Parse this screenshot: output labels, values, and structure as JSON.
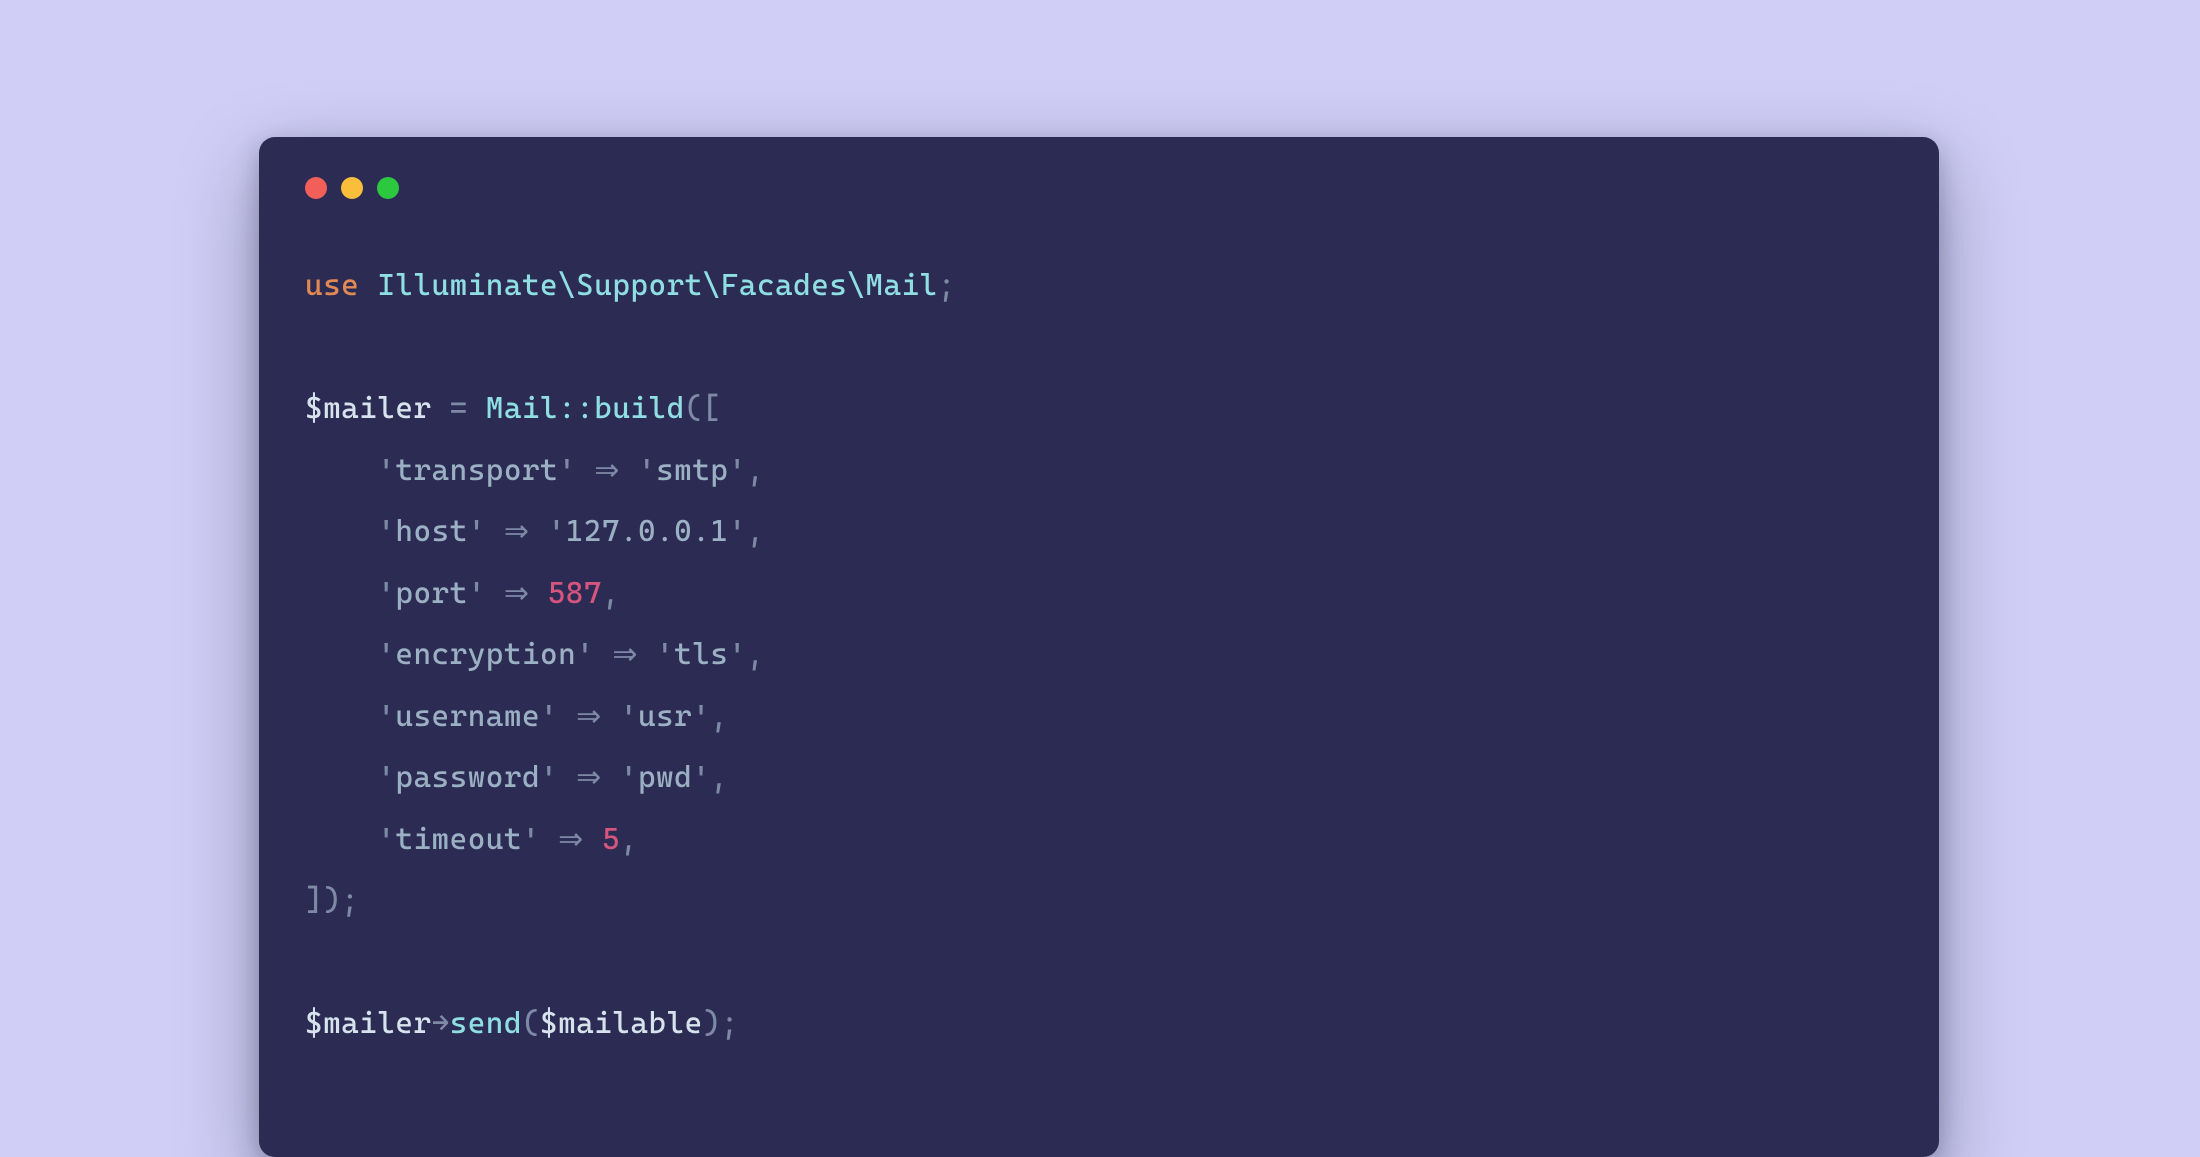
{
  "window": {
    "traffic_colors": {
      "red": "#f25f58",
      "yellow": "#fbbe3b",
      "green": "#2bc840"
    }
  },
  "code": {
    "kw_use": "use",
    "ns_path": "Illuminate\\Support\\Facades\\Mail",
    "var_mailer": "$mailer",
    "class_mail": "Mail",
    "fn_build": "build",
    "fn_send": "send",
    "var_mailable": "$mailable",
    "indent": "    ",
    "arrow": "⇒",
    "thin_arrow": "→",
    "entries": {
      "transport": {
        "key": "transport",
        "val": "smtp",
        "type": "str"
      },
      "host": {
        "key": "host",
        "val": "127.0.0.1",
        "type": "str"
      },
      "port": {
        "key": "port",
        "val": "587",
        "type": "num"
      },
      "encryption": {
        "key": "encryption",
        "val": "tls",
        "type": "str"
      },
      "username": {
        "key": "username",
        "val": "usr",
        "type": "str"
      },
      "password": {
        "key": "password",
        "val": "pwd",
        "type": "str"
      },
      "timeout": {
        "key": "timeout",
        "val": "5",
        "type": "num"
      }
    }
  }
}
